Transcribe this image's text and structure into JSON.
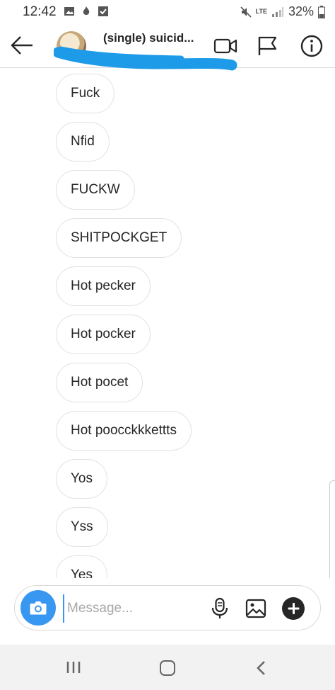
{
  "status_bar": {
    "time": "12:42",
    "network": "LTE",
    "battery": "32%",
    "icons": [
      "gallery-icon",
      "fire-icon",
      "checkbox-icon",
      "mute-icon",
      "signal-icon",
      "battery-icon"
    ]
  },
  "header": {
    "title": "(single) suicid...",
    "icons": [
      "back-arrow-icon",
      "video-camera-icon",
      "flag-icon",
      "info-icon"
    ]
  },
  "messages": [
    {
      "text": "Fuck"
    },
    {
      "text": "Nfid"
    },
    {
      "text": "FUCKW"
    },
    {
      "text": "SHITPOCKGET"
    },
    {
      "text": "Hot pecker"
    },
    {
      "text": "Hot pocker"
    },
    {
      "text": "Hot pocet"
    },
    {
      "text": "Hot poocckkkettts"
    },
    {
      "text": "Yos"
    },
    {
      "text": "Yss"
    },
    {
      "text": "Yes"
    }
  ],
  "composer": {
    "placeholder": "Message...",
    "icons": [
      "camera-icon",
      "microphone-icon",
      "image-icon",
      "plus-icon"
    ]
  },
  "colors": {
    "accent": "#3897f0",
    "scribble": "#1e9be8",
    "bubble_border": "#e1e1e1",
    "text": "#262626"
  }
}
